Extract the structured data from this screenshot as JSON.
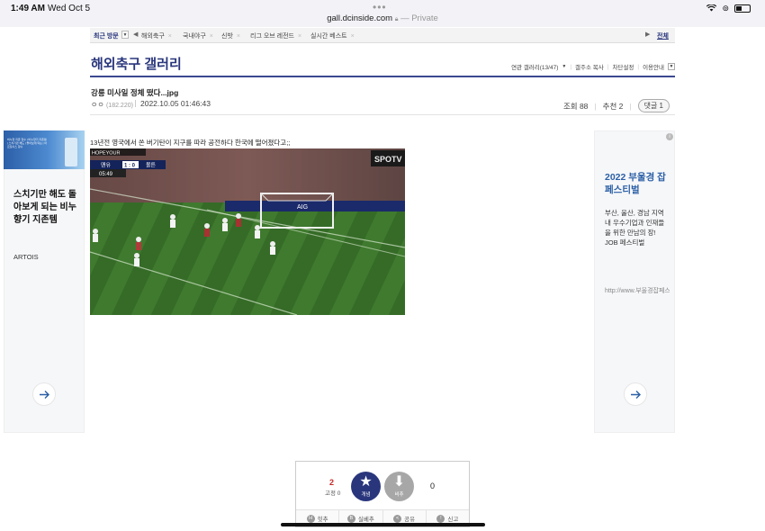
{
  "status": {
    "time": "1:49 AM",
    "date": "Wed Oct 5",
    "url": "gall.dcinside.com",
    "private_label": "— Private",
    "lock_icon": "lock-icon",
    "battery_icon": "battery-icon",
    "wifi_icon": "wifi-icon"
  },
  "topnav": {
    "recent_label": "최근 방문",
    "items": [
      "해외축구",
      "국내야구",
      "신밧",
      "리그 오브 레전드",
      "실시간 베스트"
    ],
    "all_label": "전체"
  },
  "gallery": {
    "title": "해외축구 갤러리",
    "tools": [
      "연관 갤러리(13/47)",
      "갤주소 복사",
      "차단설정",
      "이용안내"
    ]
  },
  "post": {
    "title": "강릉 미사일 정체 떴다...jpg",
    "author": "ㅇㅇ",
    "ip": "(182.220)",
    "date": "2022.10.05 01:46:43",
    "views": "조회 88",
    "recommend": "추천 2",
    "reply_label": "댓글 1",
    "content_text": "13년전 영국에서 쏜 버기탄이 지구를 따라 공전하다 한국에 떨어졌다고;;"
  },
  "gif": {
    "broadcaster": "HOPEYOUR",
    "team_home": "맨유",
    "score": "1 : 0",
    "team_away": "볼튼",
    "clock": "05:49",
    "board_text": "SPOTV",
    "aig_text": "AIG"
  },
  "ad_left": {
    "title": "스치기만 해도 돌아보게 되는 비누향기 지존템",
    "brand": "ARTOIS",
    "thumb_text": "비누향 지존 향수 | 비누향기 지존템 | 스치기만 해도 | 돌아보게 되는 | 아르토이스 향수"
  },
  "ad_right": {
    "title": "2022 부울경 잡 페스티벌",
    "body": "부산, 울산, 경남 지역 내 우수기업과 인재들을 위한 만남의 장! JOB 페스티벌",
    "url": "http://www.부울경잡페스티벌.kr"
  },
  "vote": {
    "up_count": "2",
    "fix_label": "고정 0",
    "up_label": "개념",
    "down_label": "비추",
    "down_count": "0",
    "tools": [
      {
        "icon": "H",
        "label": "힛추"
      },
      {
        "icon": "B",
        "label": "실베추"
      },
      {
        "icon": "<",
        "label": "공유"
      },
      {
        "icon": "!",
        "label": "신고"
      }
    ]
  }
}
